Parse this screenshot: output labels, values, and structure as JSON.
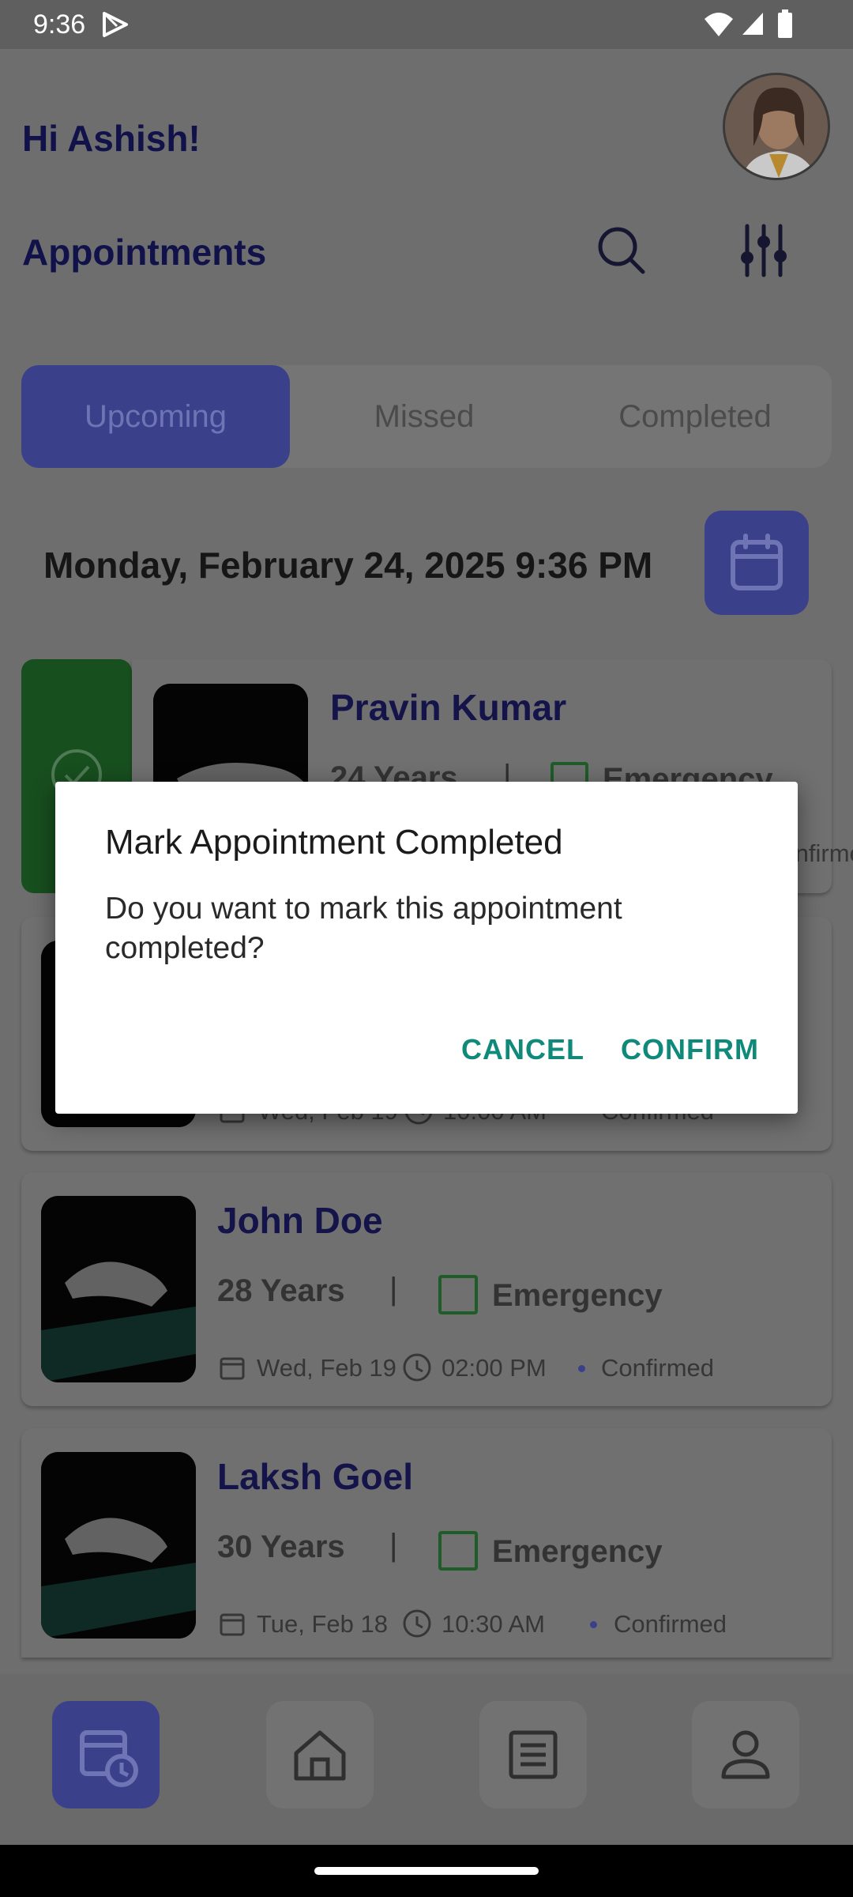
{
  "status_bar": {
    "time": "9:36"
  },
  "header": {
    "greeting": "Hi Ashish!",
    "section_title": "Appointments"
  },
  "tabs": [
    {
      "label": "Upcoming",
      "active": true
    },
    {
      "label": "Missed",
      "active": false
    },
    {
      "label": "Completed",
      "active": false
    }
  ],
  "current_datetime": "Monday, February 24, 2025 9:36 PM",
  "appointments": [
    {
      "name": "Pravin  Kumar",
      "age": "24 Years",
      "type": "Emergency",
      "status": "Confirmed"
    },
    {
      "name": "",
      "date": "Wed, Feb 19",
      "time": "10:00 AM",
      "status": "Confirmed"
    },
    {
      "name": "John  Doe",
      "age": "28 Years",
      "type": "Emergency",
      "date": "Wed, Feb 19",
      "time": "02:00 PM",
      "status": "Confirmed"
    },
    {
      "name": "Laksh  Goel",
      "age": "30 Years",
      "type": "Emergency",
      "date": "Tue, Feb 18",
      "time": "10:30 AM",
      "status": "Confirmed"
    }
  ],
  "separator": "|",
  "dialog": {
    "title": "Mark Appointment Completed",
    "message": "Do you want to mark this appointment completed?",
    "cancel": "CANCEL",
    "confirm": "CONFIRM"
  },
  "bottom_nav": [
    {
      "icon": "calendar-clock-icon",
      "active": true
    },
    {
      "icon": "home-icon",
      "active": false
    },
    {
      "icon": "list-icon",
      "active": false
    },
    {
      "icon": "person-icon",
      "active": false
    }
  ],
  "colors": {
    "accent": "#3a418a",
    "dialog_action": "#0f8a7a",
    "complete_green": "#184f1f"
  }
}
